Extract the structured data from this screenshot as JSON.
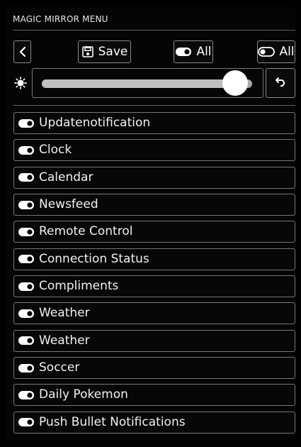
{
  "menu": {
    "title": "MAGIC MIRROR MENU"
  },
  "toolbar": {
    "back_icon": "chevron-left-icon",
    "save_label": "Save",
    "save_icon": "floppy-save-icon",
    "all_on_label": "All",
    "all_on_icon": "toggle-on-icon",
    "all_off_label": "All",
    "all_off_icon": "toggle-off-icon"
  },
  "brightness": {
    "icon": "brightness-icon",
    "value_percent": 92,
    "reset_icon": "undo-icon"
  },
  "modules": [
    {
      "label": "Updatenotification",
      "icon": "toggle-on-icon"
    },
    {
      "label": "Clock",
      "icon": "toggle-on-icon"
    },
    {
      "label": "Calendar",
      "icon": "toggle-on-icon"
    },
    {
      "label": "Newsfeed",
      "icon": "toggle-on-icon"
    },
    {
      "label": "Remote Control",
      "icon": "toggle-on-icon"
    },
    {
      "label": "Connection Status",
      "icon": "toggle-on-icon"
    },
    {
      "label": "Compliments",
      "icon": "toggle-on-icon"
    },
    {
      "label": "Weather",
      "icon": "toggle-on-icon"
    },
    {
      "label": "Weather",
      "icon": "toggle-on-icon"
    },
    {
      "label": "Soccer",
      "icon": "toggle-on-icon"
    },
    {
      "label": "Daily Pokemon",
      "icon": "toggle-on-icon"
    },
    {
      "label": "Push Bullet Notifications",
      "icon": "toggle-on-icon"
    }
  ]
}
